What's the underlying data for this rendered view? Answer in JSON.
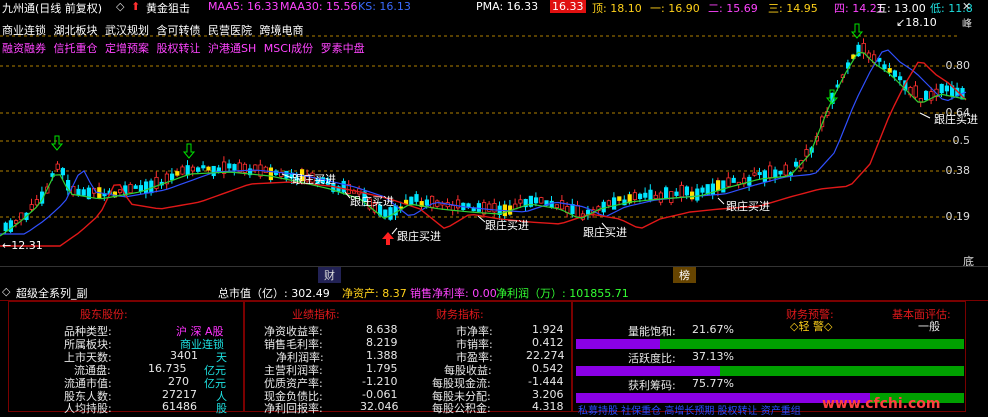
{
  "window": {
    "title": "九州通(日线 前复权)",
    "indicator_name": "黄金狙击",
    "maa5_label": "MAA5: 16.33",
    "maa30_label": "MAA30: 15.56",
    "ks_label": "KS: 16.13",
    "pma_label": "PMA: 16.33",
    "pma_red_value": "16.33",
    "ding_label": "顶: 18.10",
    "yi_label": "一: 16.90",
    "er_label": "二: 15.69",
    "san_label": "三: 14.95",
    "si_label": "四: 14.21",
    "wu_label": "五: 13.00",
    "di_label": "低: 11.8"
  },
  "concepts": {
    "line1": [
      "商业连锁",
      "湖北板块",
      "武汉规划",
      "含可转债",
      "民营医院",
      "跨境电商"
    ],
    "line2": [
      "融资融券",
      "信托重仓",
      "定增预案",
      "股权转让",
      "沪港通SH",
      "MSCI成份",
      "罗素中盘"
    ]
  },
  "chart_labels": {
    "high_marker": "18.10",
    "low_marker": "12.31",
    "buy_label": "跟庄买进",
    "axis_right": [
      "0.80",
      "0.64",
      "0.5",
      "0.38",
      "0.19"
    ],
    "top_right": "峰",
    "bottom_right": "底"
  },
  "fin_bar": {
    "cai": "财",
    "bang": "榜"
  },
  "sub_panel": {
    "title": "超级全系列_副",
    "market_cap": "总市值（亿）: 302.49",
    "net_assets": "净资产: 8.37",
    "net_margin": "销售净利率: 0.00",
    "net_profit": "净利润（万）: 101855.71"
  },
  "table": {
    "stock_header": "股东股份:",
    "perf_header": "业绩指标:",
    "finance_header": "财务指标:",
    "warning_header": "财务预警:",
    "warning_value": "◇轻 警◇",
    "basic_header": "基本面评估:",
    "basic_value": "一般",
    "stock_rows": [
      {
        "label": "品种类型:",
        "value": "沪 深 A股",
        "unit": ""
      },
      {
        "label": "所属板块:",
        "value": "商业连锁",
        "unit": ""
      },
      {
        "label": "上市天数:",
        "value": "3401",
        "unit": "天"
      },
      {
        "label": "流通盘:",
        "value": "16.735",
        "unit": "亿元"
      },
      {
        "label": "流通市值:",
        "value": "270",
        "unit": "亿元"
      },
      {
        "label": "股东人数:",
        "value": "27217",
        "unit": "人"
      },
      {
        "label": "人均持股:",
        "value": "61486",
        "unit": "股"
      }
    ],
    "perf_rows": [
      {
        "label": "净资收益率:",
        "value": "8.638"
      },
      {
        "label": "销售毛利率:",
        "value": "8.219"
      },
      {
        "label": "净利润率:",
        "value": "1.388"
      },
      {
        "label": "主营利润率:",
        "value": "1.795"
      },
      {
        "label": "优质资产率:",
        "value": "-1.210"
      },
      {
        "label": "现金负债比:",
        "value": "-0.061"
      },
      {
        "label": "净利回报率:",
        "value": "32.046"
      }
    ],
    "fin_rows": [
      {
        "label": "市净率:",
        "value": "1.924"
      },
      {
        "label": "市销率:",
        "value": "0.412"
      },
      {
        "label": "市盈率:",
        "value": "22.274"
      },
      {
        "label": "每股收益:",
        "value": "0.542"
      },
      {
        "label": "每股现金流:",
        "value": "-1.444"
      },
      {
        "label": "每股未分配:",
        "value": "3.206"
      },
      {
        "label": "每股公积金:",
        "value": "4.318"
      }
    ],
    "gauges": [
      {
        "label": "量能饱和:",
        "value": "21.67%",
        "fraction": 0.2167
      },
      {
        "label": "活跃度比:",
        "value": "37.13%",
        "fraction": 0.3713
      },
      {
        "label": "获利筹码:",
        "value": "75.77%",
        "fraction": 0.7577
      }
    ],
    "footer_text": "私募持股 社保重仓 高增长预期 股权转让 资产重组",
    "watermark": "www.cfchi.com"
  },
  "colors": {
    "up": "#ff3030",
    "down": "#00e5ff",
    "line_yellow": "#ffd000",
    "line_green": "#32d232",
    "line_blue": "#3050ff",
    "line_red": "#e01818",
    "grid": "#b08000"
  }
}
